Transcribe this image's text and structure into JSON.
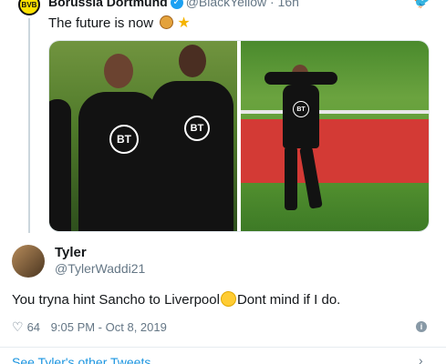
{
  "parent_tweet": {
    "avatar_text": "BVB",
    "author_name": "Borussia Dortmund",
    "handle": "@BlackYellow",
    "time": "16h",
    "separator": "·",
    "text": "The future is now",
    "icons": [
      "bvb-logo",
      "verified-badge",
      "twitter-bird-icon",
      "lion-emoji",
      "star-emoji"
    ],
    "brand_color": "#1da1f2",
    "photos": [
      {
        "logo_text": "BT",
        "logo_text_2": "BT"
      },
      {
        "logo_text": "BT"
      }
    ]
  },
  "reply_tweet": {
    "author_name": "Tyler",
    "handle": "@TylerWaddi21",
    "text_before": "You tryna hint Sancho to Liverpool",
    "text_after": "Dont mind if I do.",
    "likes": "64",
    "timestamp": "9:05 PM - Oct 8, 2019",
    "icons": [
      "heart-icon",
      "info-icon",
      "smirk-emoji"
    ]
  },
  "footer": {
    "see_more": "See Tyler's other Tweets",
    "icons": [
      "chevron-right-icon"
    ]
  }
}
